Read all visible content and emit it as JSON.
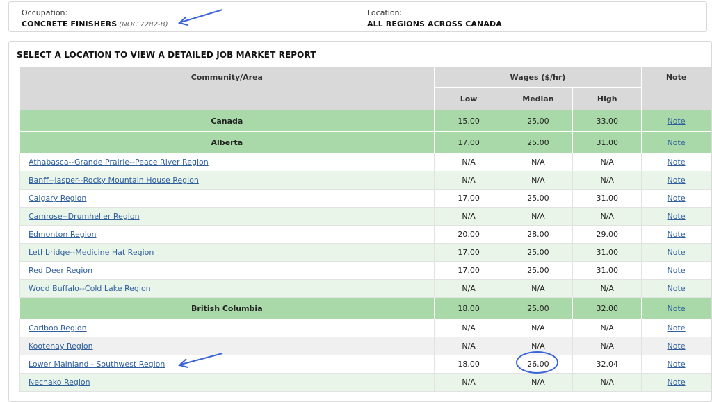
{
  "occupation": {
    "label": "Occupation:",
    "value": "CONCRETE FINISHERS",
    "code": "(NOC 7282-B)"
  },
  "location": {
    "label": "Location:",
    "value": "ALL REGIONS ACROSS CANADA"
  },
  "report": {
    "title": "SELECT A LOCATION TO VIEW A DETAILED JOB MARKET REPORT",
    "headers": {
      "community": "Community/Area",
      "wages": "Wages ($/hr)",
      "note": "Note",
      "low": "Low",
      "median": "Median",
      "high": "High"
    },
    "rows": [
      {
        "name": "Canada",
        "low": "15.00",
        "median": "25.00",
        "high": "33.00",
        "note": "Note"
      },
      {
        "name": "Alberta",
        "low": "17.00",
        "median": "25.00",
        "high": "31.00",
        "note": "Note"
      },
      {
        "name": "Athabasca--Grande Prairie--Peace River Region",
        "low": "N/A",
        "median": "N/A",
        "high": "N/A",
        "note": "Note"
      },
      {
        "name": "Banff--Jasper--Rocky Mountain House Region",
        "low": "N/A",
        "median": "N/A",
        "high": "N/A",
        "note": "Note"
      },
      {
        "name": "Calgary Region",
        "low": "17.00",
        "median": "25.00",
        "high": "31.00",
        "note": "Note"
      },
      {
        "name": "Camrose--Drumheller Region",
        "low": "N/A",
        "median": "N/A",
        "high": "N/A",
        "note": "Note"
      },
      {
        "name": "Edmonton Region",
        "low": "20.00",
        "median": "28.00",
        "high": "29.00",
        "note": "Note"
      },
      {
        "name": "Lethbridge--Medicine Hat Region",
        "low": "17.00",
        "median": "25.00",
        "high": "31.00",
        "note": "Note"
      },
      {
        "name": "Red Deer Region",
        "low": "17.00",
        "median": "25.00",
        "high": "31.00",
        "note": "Note"
      },
      {
        "name": "Wood Buffalo--Cold Lake Region",
        "low": "N/A",
        "median": "N/A",
        "high": "N/A",
        "note": "Note"
      },
      {
        "name": "British Columbia",
        "low": "18.00",
        "median": "25.00",
        "high": "32.00",
        "note": "Note"
      },
      {
        "name": "Cariboo Region",
        "low": "N/A",
        "median": "N/A",
        "high": "N/A",
        "note": "Note"
      },
      {
        "name": "Kootenay Region",
        "low": "N/A",
        "median": "N/A",
        "high": "N/A",
        "note": "Note"
      },
      {
        "name": "Lower Mainland - Southwest Region",
        "low": "18.00",
        "median": "26.00",
        "high": "32.04",
        "note": "Note"
      },
      {
        "name": "Nechako Region",
        "low": "N/A",
        "median": "N/A",
        "high": "N/A",
        "note": "Note"
      }
    ]
  },
  "annotation_color": "#3a64d8"
}
